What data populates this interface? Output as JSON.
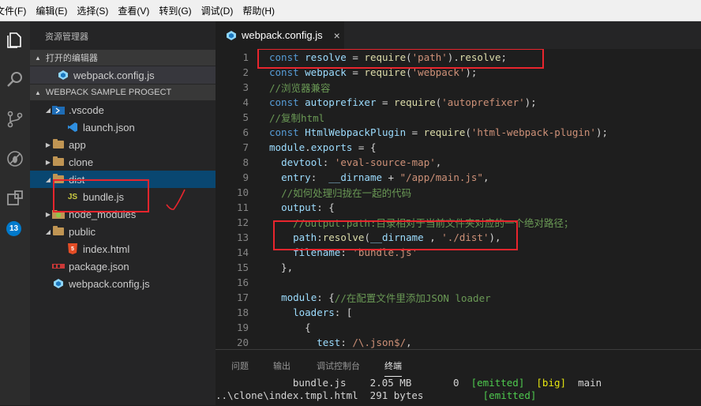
{
  "menu": [
    "文件(F)",
    "编辑(E)",
    "选择(S)",
    "查看(V)",
    "转到(G)",
    "调试(D)",
    "帮助(H)"
  ],
  "activity": {
    "icons": [
      "files-icon",
      "search-icon",
      "source-control-icon",
      "debug-icon",
      "extensions-icon"
    ],
    "badge": "13"
  },
  "sidebar": {
    "title": "资源管理器",
    "open_editors_label": "打开的编辑器",
    "open_editor_file": "webpack.config.js",
    "project_label": "WEBPACK SAMPLE PROGECT",
    "tree": [
      {
        "label": ".vscode",
        "type": "folder-open",
        "indent": 1
      },
      {
        "label": "launch.json",
        "type": "vscode-json",
        "indent": 2
      },
      {
        "label": "app",
        "type": "folder",
        "indent": 1
      },
      {
        "label": "clone",
        "type": "folder",
        "indent": 1
      },
      {
        "label": "dist",
        "type": "folder-open",
        "indent": 1
      },
      {
        "label": "bundle.js",
        "type": "js",
        "indent": 2
      },
      {
        "label": "node_modules",
        "type": "folder-node",
        "indent": 1
      },
      {
        "label": "public",
        "type": "folder-open",
        "indent": 1
      },
      {
        "label": "index.html",
        "type": "html",
        "indent": 2
      },
      {
        "label": "package.json",
        "type": "npm",
        "indent": 1
      },
      {
        "label": "webpack.config.js",
        "type": "webpack",
        "indent": 1
      }
    ]
  },
  "editor": {
    "tab_label": "webpack.config.js",
    "close_glyph": "×",
    "line_numbers": [
      "1",
      "2",
      "3",
      "4",
      "5",
      "6",
      "7",
      "8",
      "9",
      "10",
      "11",
      "12",
      "13",
      "14",
      "15",
      "16",
      "17",
      "18",
      "19",
      "20"
    ],
    "lines": [
      [
        [
          "k",
          "const "
        ],
        [
          "v",
          "resolve"
        ],
        [
          "p",
          " = "
        ],
        [
          "f",
          "require"
        ],
        [
          "p",
          "("
        ],
        [
          "s",
          "'path'"
        ],
        [
          "p",
          ")."
        ],
        [
          "f",
          "resolve"
        ],
        [
          "p",
          ";"
        ]
      ],
      [
        [
          "k",
          "const "
        ],
        [
          "v",
          "webpack"
        ],
        [
          "p",
          " = "
        ],
        [
          "f",
          "require"
        ],
        [
          "p",
          "("
        ],
        [
          "s",
          "'webpack'"
        ],
        [
          "p",
          ");"
        ]
      ],
      [
        [
          "c",
          "//浏览器兼容"
        ]
      ],
      [
        [
          "k",
          "const "
        ],
        [
          "v",
          "autoprefixer"
        ],
        [
          "p",
          " = "
        ],
        [
          "f",
          "require"
        ],
        [
          "p",
          "("
        ],
        [
          "s",
          "'autoprefixer'"
        ],
        [
          "p",
          ");"
        ]
      ],
      [
        [
          "c",
          "//复制html"
        ]
      ],
      [
        [
          "k",
          "const "
        ],
        [
          "v",
          "HtmlWebpackPlugin"
        ],
        [
          "p",
          " = "
        ],
        [
          "f",
          "require"
        ],
        [
          "p",
          "("
        ],
        [
          "s",
          "'html-webpack-plugin'"
        ],
        [
          "p",
          ");"
        ]
      ],
      [
        [
          "v",
          "module"
        ],
        [
          "p",
          "."
        ],
        [
          "v",
          "exports"
        ],
        [
          "p",
          " = {"
        ]
      ],
      [
        [
          "p",
          "  "
        ],
        [
          "v",
          "devtool"
        ],
        [
          "p",
          ": "
        ],
        [
          "s",
          "'eval-source-map'"
        ],
        [
          "p",
          ","
        ]
      ],
      [
        [
          "p",
          "  "
        ],
        [
          "v",
          "entry"
        ],
        [
          "p",
          ":  "
        ],
        [
          "v",
          "__dirname"
        ],
        [
          "p",
          " + "
        ],
        [
          "s",
          "\"/app/main.js\""
        ],
        [
          "p",
          ","
        ]
      ],
      [
        [
          "p",
          "  "
        ],
        [
          "c",
          "//如何处理归拢在一起的代码"
        ]
      ],
      [
        [
          "p",
          "  "
        ],
        [
          "v",
          "output"
        ],
        [
          "p",
          ": {"
        ]
      ],
      [
        [
          "p",
          "    "
        ],
        [
          "c",
          "//output.path:目录相对于当前文件夹对应的一个绝对路径；"
        ]
      ],
      [
        [
          "p",
          "    "
        ],
        [
          "v",
          "path"
        ],
        [
          "p",
          ":"
        ],
        [
          "f",
          "resolve"
        ],
        [
          "p",
          "("
        ],
        [
          "v",
          "__dirname"
        ],
        [
          "p",
          " , "
        ],
        [
          "s",
          "'./dist'"
        ],
        [
          "p",
          "),"
        ]
      ],
      [
        [
          "p",
          "    "
        ],
        [
          "v",
          "filename"
        ],
        [
          "p",
          ": "
        ],
        [
          "s",
          "'bundle.js'"
        ]
      ],
      [
        [
          "p",
          "  },"
        ]
      ],
      [
        [
          "p",
          ""
        ]
      ],
      [
        [
          "p",
          "  "
        ],
        [
          "v",
          "module"
        ],
        [
          "p",
          ": {"
        ],
        [
          "c",
          "//在配置文件里添加JSON loader"
        ]
      ],
      [
        [
          "p",
          "    "
        ],
        [
          "v",
          "loaders"
        ],
        [
          "p",
          ": ["
        ]
      ],
      [
        [
          "p",
          "      {"
        ]
      ],
      [
        [
          "p",
          "        "
        ],
        [
          "v",
          "test"
        ],
        [
          "p",
          ": "
        ],
        [
          "s",
          "/\\.json$/"
        ],
        [
          "p",
          ","
        ]
      ]
    ]
  },
  "panel": {
    "tabs": [
      "问题",
      "输出",
      "调试控制台",
      "终端"
    ],
    "active_tab": "终端",
    "term_rows": [
      [
        [
          "p",
          "             bundle.js    2.05 MB       0  "
        ],
        [
          "green",
          "[emitted]"
        ],
        [
          "p",
          "  "
        ],
        [
          "yellow",
          "[big]"
        ],
        [
          "p",
          "  main"
        ]
      ],
      [
        [
          "p",
          "..\\clone\\index.tmpl.html  291 bytes          "
        ],
        [
          "green",
          "[emitted]"
        ]
      ]
    ]
  },
  "colors": {
    "annotation_red": "#e8252d",
    "keyword": "#569cd6",
    "string": "#ce9178",
    "comment": "#6a9955",
    "selection": "#094771",
    "badge": "#007acc"
  }
}
